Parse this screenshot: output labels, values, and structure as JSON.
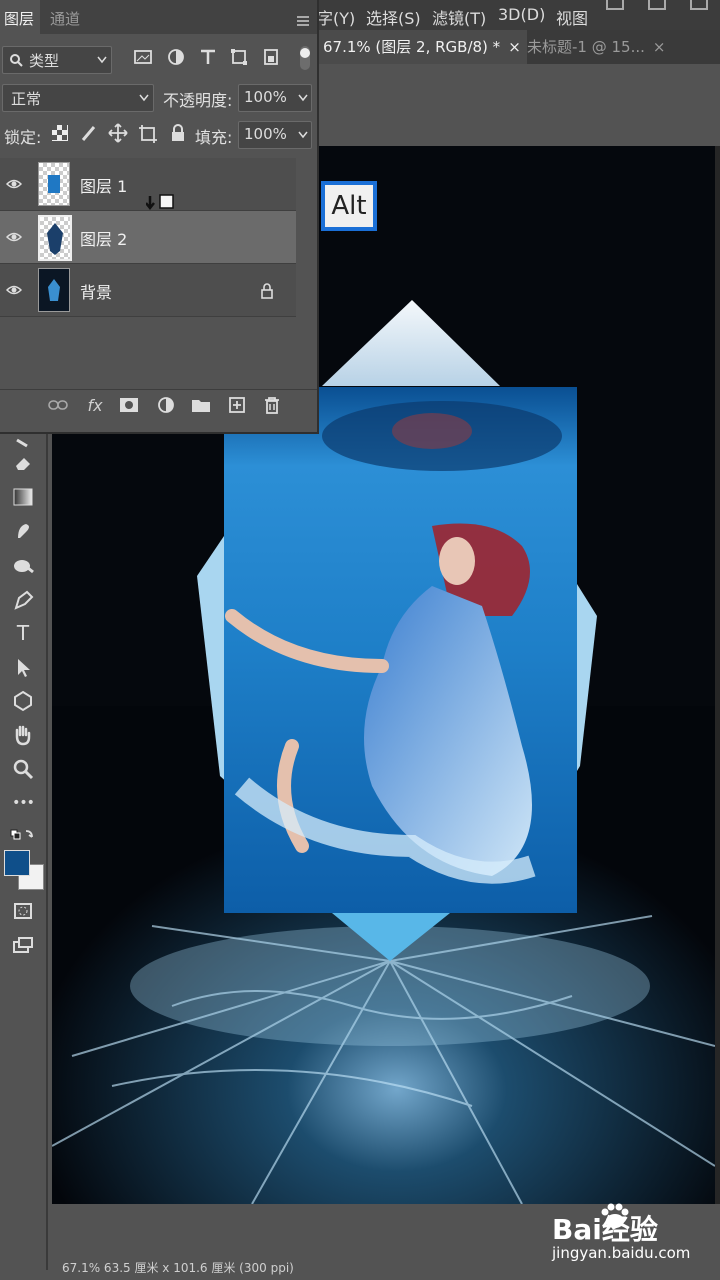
{
  "menubar": {
    "items": [
      "字(Y)",
      "选择(S)",
      "滤镜(T)",
      "3D(D)",
      "视图"
    ]
  },
  "tabs": [
    {
      "label": "67.1% (图层 2, RGB/8) *",
      "close": "×",
      "active": true
    },
    {
      "label": "未标题-1 @ 15...",
      "close": "×",
      "active": false
    }
  ],
  "layers_panel": {
    "tab_layers": "图层",
    "tab_channels": "通道",
    "filter_kind": "类型",
    "blend_mode": "正常",
    "opacity_label": "不透明度:",
    "opacity_value": "100%",
    "lock_label": "锁定:",
    "fill_label": "填充:",
    "fill_value": "100%",
    "layers": [
      {
        "name": "图层 1",
        "visible": true,
        "selected": false,
        "locked": false
      },
      {
        "name": "图层 2",
        "visible": true,
        "selected": true,
        "locked": false
      },
      {
        "name": "背景",
        "visible": true,
        "selected": false,
        "locked": true
      }
    ],
    "footer_icons": [
      "link-icon",
      "fx-icon",
      "mask-icon",
      "adjustment-icon",
      "folder-icon",
      "new-layer-icon",
      "trash-icon"
    ],
    "fx_label": "fx"
  },
  "overlay": {
    "alt_key": "Alt"
  },
  "toolbar": {
    "tools": [
      "eraser-icon",
      "gradient-icon",
      "smudge-icon",
      "dodge-icon",
      "pen-icon",
      "type-icon",
      "path-select-icon",
      "shape-icon",
      "hand-icon",
      "zoom-icon",
      "more-icon",
      "swap-colors-icon",
      "color-swatch",
      "quick-mask-icon",
      "screen-mode-icon"
    ],
    "type_glyph": "T",
    "more_glyph": "•••"
  },
  "colors": {
    "foreground": "#0f4f8a",
    "background": "#f2f2f2",
    "selection_blue": "#1a6fd6"
  },
  "status": {
    "text": "67.1%    63.5 厘米 x 101.6 厘米 (300 ppi)"
  },
  "watermark": {
    "brand": "Bai经验",
    "url": "jingyan.baidu.com"
  }
}
